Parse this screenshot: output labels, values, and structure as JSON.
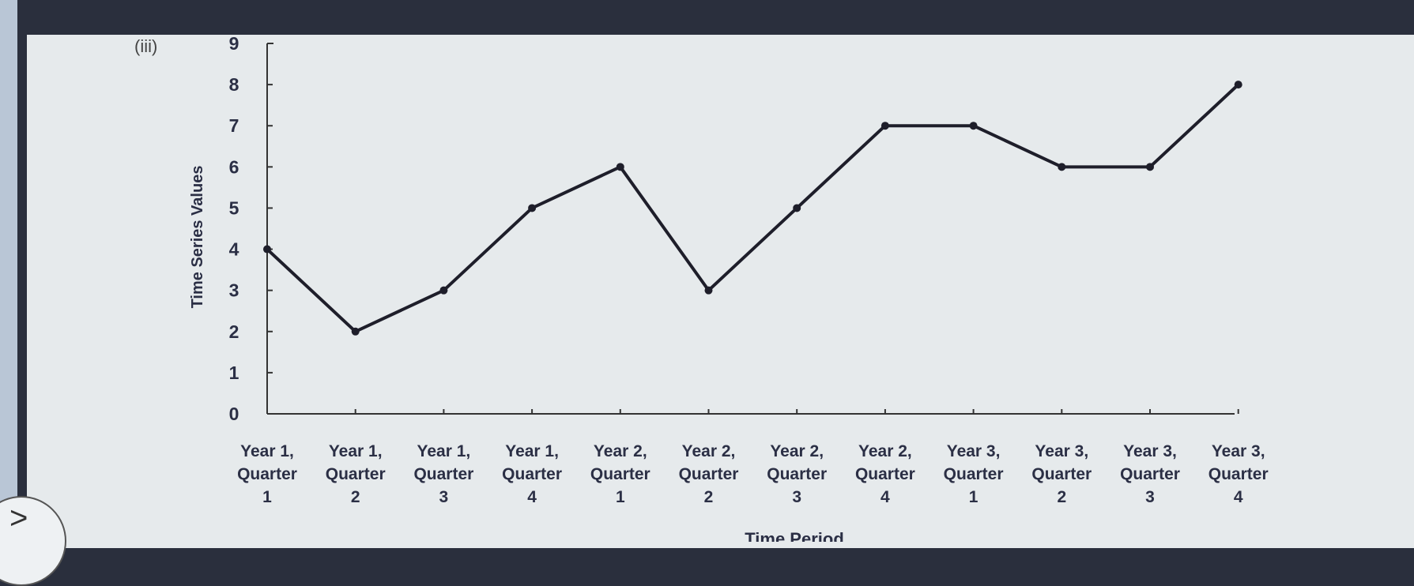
{
  "label": "(iii)",
  "chart_data": {
    "type": "line",
    "title": "",
    "xlabel": "Time Period",
    "ylabel": "Time Series Values",
    "ylim": [
      0,
      9
    ],
    "yticks": [
      0,
      1,
      2,
      3,
      4,
      5,
      6,
      7,
      8,
      9
    ],
    "grid": false,
    "categories": [
      [
        "Year 1,",
        "Quarter",
        "1"
      ],
      [
        "Year 1,",
        "Quarter",
        "2"
      ],
      [
        "Year 1,",
        "Quarter",
        "3"
      ],
      [
        "Year 1,",
        "Quarter",
        "4"
      ],
      [
        "Year 2,",
        "Quarter",
        "1"
      ],
      [
        "Year 2,",
        "Quarter",
        "2"
      ],
      [
        "Year 2,",
        "Quarter",
        "3"
      ],
      [
        "Year 2,",
        "Quarter",
        "4"
      ],
      [
        "Year 3,",
        "Quarter",
        "1"
      ],
      [
        "Year 3,",
        "Quarter",
        "2"
      ],
      [
        "Year 3,",
        "Quarter",
        "3"
      ],
      [
        "Year 3,",
        "Quarter",
        "4"
      ]
    ],
    "values": [
      4,
      2,
      3,
      5,
      6,
      3,
      5,
      7,
      7,
      6,
      6,
      8
    ],
    "line_color": "#1e1e2a"
  }
}
